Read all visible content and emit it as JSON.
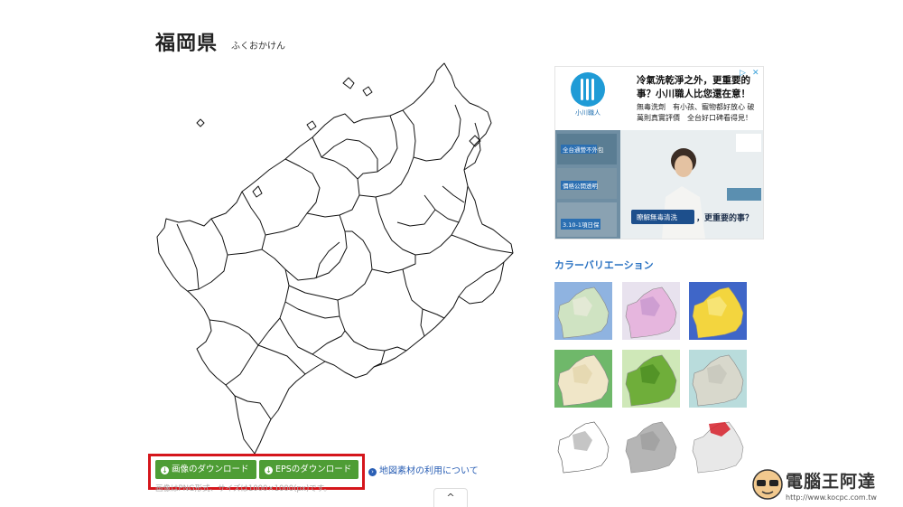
{
  "page": {
    "title": "福岡県",
    "reading": "ふくおかけん"
  },
  "ad": {
    "brand": "小川職人",
    "headline": "冷氣洗乾淨之外，更重要的事？小川職人比您還在意！",
    "body": "無毒洗劑　有小孩、寵物都好放心 破萬則真實評價　全台好口碑看得見！",
    "img_tags": [
      "全台通營不外包",
      "價格公開透明",
      "3.10-1項日保"
    ],
    "img_caption": "瞭解無毒清洗",
    "img_tail": "，更重要的事？",
    "choice_icons": [
      "adchoices-icon",
      "close-icon"
    ]
  },
  "color_variation": {
    "heading": "カラーバリエーション",
    "thumbnails": [
      {
        "name": "variation-pastel-blue",
        "bg": "#8fb3e0",
        "fill": "#cfe3c2",
        "accent": "#e6ead8"
      },
      {
        "name": "variation-pink-purple",
        "bg": "#e8e2ee",
        "fill": "#e6b6de",
        "accent": "#c99ad0"
      },
      {
        "name": "variation-yellow-blue",
        "bg": "#3f66c8",
        "fill": "#f3d53e",
        "accent": "#f7e67e"
      },
      {
        "name": "variation-green-tan",
        "bg": "#6fb86a",
        "fill": "#f0e6c8",
        "accent": "#e4d6ae"
      },
      {
        "name": "variation-green-dark",
        "bg": "#cfe8b8",
        "fill": "#6fae3a",
        "accent": "#4f8f25"
      },
      {
        "name": "variation-gray-teal",
        "bg": "#b9dcdc",
        "fill": "#d8d8cc",
        "accent": "#c8c8bc"
      },
      {
        "name": "variation-outline-white",
        "bg": "#ffffff",
        "fill": "#ffffff",
        "accent": "#bbbbbb"
      },
      {
        "name": "variation-gray-solid",
        "bg": "#ffffff",
        "fill": "#b5b5b5",
        "accent": "#a0a0a0"
      },
      {
        "name": "variation-kyushu-red",
        "bg": "#ffffff",
        "fill": "#e8e8e8",
        "accent": "#d6202a"
      }
    ]
  },
  "actions": {
    "download_image": "画像のダウンロード",
    "download_eps": "EPSのダウンロード",
    "usage_link": "地図素材の利用について",
    "format_note": "画像はPNG形式、サイズは1000×1000(px)です。",
    "scroll_top": "^"
  },
  "watermark": {
    "name": "電腦王阿達",
    "url": "http://www.kocpc.com.tw"
  },
  "colors": {
    "accent_blue": "#2a72c2",
    "button_green": "#4e9d35",
    "highlight_red": "#d5161c",
    "map_stroke": "#111111"
  }
}
